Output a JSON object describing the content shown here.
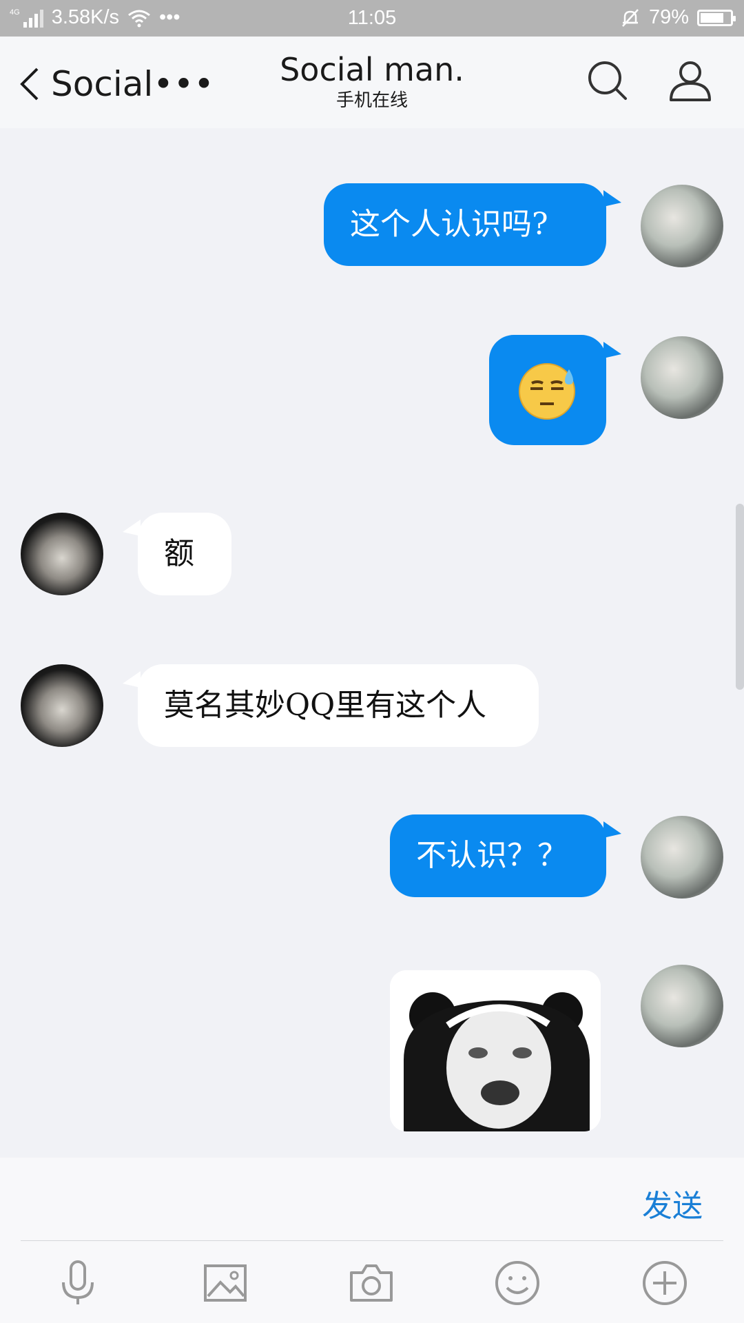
{
  "status_bar": {
    "network": "4G",
    "speed": "3.58K/s",
    "more": "•••",
    "time": "11:05",
    "battery": "79%",
    "battery_level": 0.79
  },
  "header": {
    "back_label": "Social•••",
    "title": "Social man.",
    "subtitle": "手机在线"
  },
  "messages": [
    {
      "side": "out",
      "type": "text",
      "text": "这个人认识吗?"
    },
    {
      "side": "out",
      "type": "emoji",
      "icon": "sweat-smile-emoji-icon"
    },
    {
      "side": "in",
      "type": "text",
      "text": "额"
    },
    {
      "side": "in",
      "type": "text",
      "text": "莫名其妙QQ里有这个人"
    },
    {
      "side": "out",
      "type": "text",
      "text": "不认识？？"
    },
    {
      "side": "out",
      "type": "sticker",
      "icon": "panda-meme-sticker-icon"
    }
  ],
  "input": {
    "value": "",
    "send_label": "发送"
  },
  "toolbar": [
    "microphone-icon",
    "image-icon",
    "camera-icon",
    "smiley-icon",
    "plus-icon"
  ],
  "colors": {
    "accent": "#0a8af0",
    "send_text": "#1a7fd6",
    "background": "#f1f2f6",
    "status_bar": "#b4b4b4"
  }
}
